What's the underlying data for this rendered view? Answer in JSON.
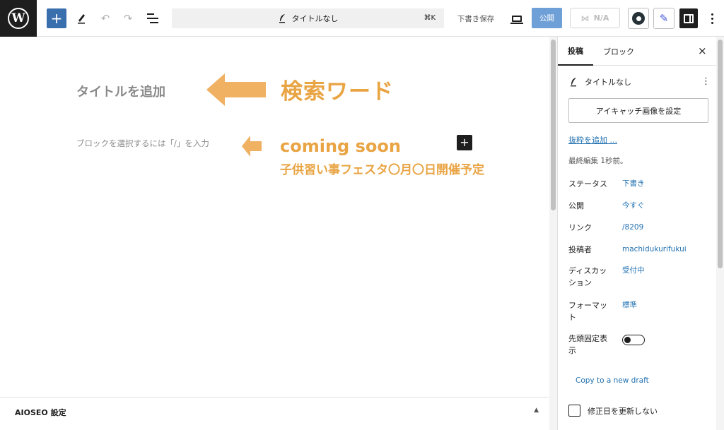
{
  "toolbar": {
    "logo_letter": "W",
    "add_block_icon": "plus-icon",
    "undo_icon": "undo-icon",
    "redo_icon": "redo-icon",
    "doc_title": "タイトルなし",
    "shortcut": "⌘K",
    "save_draft_label": "下書き保存",
    "publish_label": "公開",
    "na_label": "N/A",
    "accent_color": "#3a6fae"
  },
  "canvas": {
    "title_placeholder": "タイトルを追加",
    "block_placeholder": "ブロックを選択するには「/」を入力",
    "annotation_search": "検索ワード",
    "annotation_coming": "coming soon",
    "annotation_festa": "子供習い事フェスタ〇月〇日開催予定",
    "annotation_color": "#e9a444",
    "aioseo_label": "AIOSEO 設定"
  },
  "sidebar": {
    "tab_post": "投稿",
    "tab_block": "ブロック",
    "close_glyph": "×",
    "post_title": "タイトルなし",
    "featured_image_label": "アイキャッチ画像を設定",
    "excerpt_link": "抜粋を追加 ...",
    "last_edited": "最終編集 1秒前。",
    "status": {
      "key": "ステータス",
      "value": "下書き"
    },
    "publish": {
      "key": "公開",
      "value": "今すぐ"
    },
    "link": {
      "key": "リンク",
      "value": "/8209"
    },
    "author": {
      "key": "投稿者",
      "value": "machidukurifukui"
    },
    "discussion": {
      "key_1": "ディスカッ",
      "key_2": "ション",
      "value": "受付中"
    },
    "format": {
      "key_1": "フォーマッ",
      "key_2": "ト",
      "value": "標準"
    },
    "sticky": {
      "key_1": "先頭固定表",
      "key_2": "示",
      "enabled": false
    },
    "copy_draft_link": "Copy to a new draft",
    "update_modified_label": "修正日を更新しない",
    "link_color": "#2271b1"
  }
}
